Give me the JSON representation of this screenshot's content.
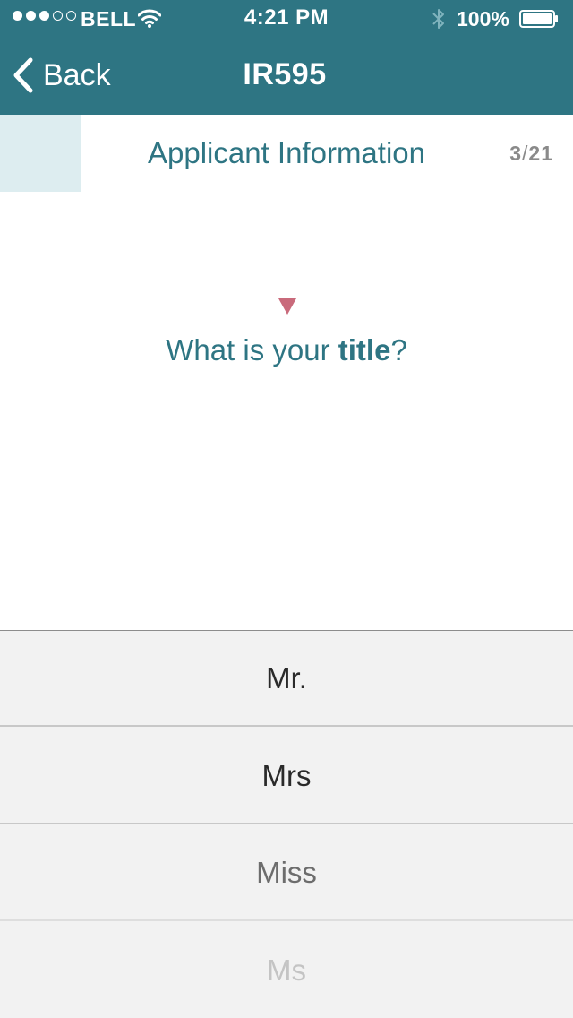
{
  "status_bar": {
    "signal_dots": [
      "on",
      "on",
      "on",
      "off",
      "off"
    ],
    "carrier": "BELL",
    "time": "4:21 PM",
    "battery_percent": "100%",
    "icons": [
      "wifi-icon",
      "bluetooth-icon",
      "battery-icon"
    ]
  },
  "nav": {
    "back_label": "Back",
    "title": "IR595"
  },
  "section": {
    "title": "Applicant Information",
    "step_current": "3",
    "step_separator": "/",
    "step_total": "21",
    "progress_fraction": 0.1429
  },
  "question": {
    "prefix": "What is your ",
    "emphasis": "title",
    "suffix": "?"
  },
  "picker": {
    "options": [
      "Mr.",
      "Mrs",
      "Miss",
      "Ms"
    ]
  },
  "colors": {
    "primary": "#2e7583",
    "progress_fill": "#ddedf0",
    "marker": "#c96a7b",
    "picker_bg": "#f2f2f2",
    "muted_text": "#8a8a8a"
  }
}
